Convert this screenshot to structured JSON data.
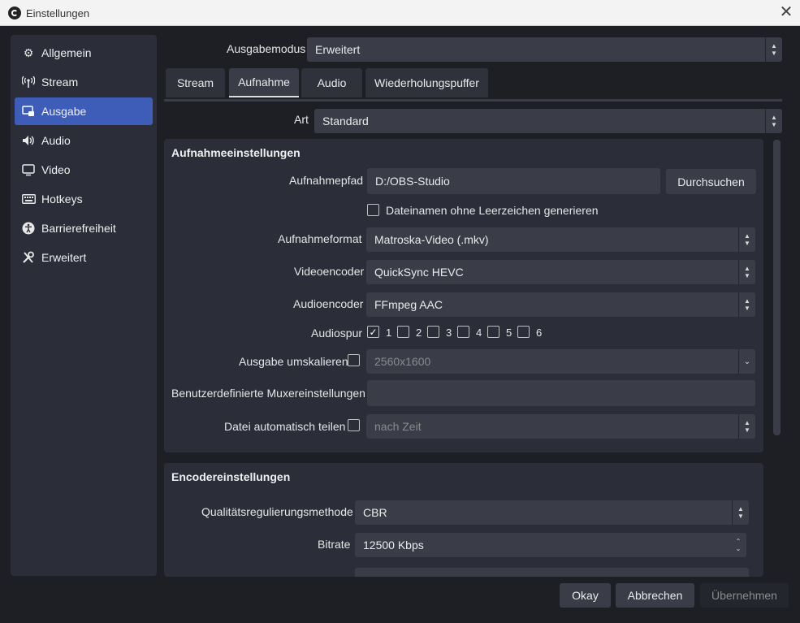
{
  "window": {
    "title": "Einstellungen"
  },
  "sidebar": {
    "items": [
      {
        "label": "Allgemein",
        "icon": "gear-icon"
      },
      {
        "label": "Stream",
        "icon": "antenna-icon"
      },
      {
        "label": "Ausgabe",
        "icon": "output-icon",
        "active": true
      },
      {
        "label": "Audio",
        "icon": "speaker-icon"
      },
      {
        "label": "Video",
        "icon": "monitor-icon"
      },
      {
        "label": "Hotkeys",
        "icon": "keyboard-icon"
      },
      {
        "label": "Barrierefreiheit",
        "icon": "accessibility-icon"
      },
      {
        "label": "Erweitert",
        "icon": "tools-icon"
      }
    ]
  },
  "output_mode": {
    "label": "Ausgabemodus",
    "value": "Erweitert"
  },
  "tabs": [
    {
      "label": "Stream"
    },
    {
      "label": "Aufnahme",
      "active": true
    },
    {
      "label": "Audio"
    },
    {
      "label": "Wiederholungspuffer"
    }
  ],
  "art": {
    "label": "Art",
    "value": "Standard"
  },
  "recording": {
    "title": "Aufnahmeeinstellungen",
    "path_label": "Aufnahmepfad",
    "path_value": "D:/OBS-Studio",
    "browse_label": "Durchsuchen",
    "nospace_label": "Dateinamen ohne Leerzeichen generieren",
    "format_label": "Aufnahmeformat",
    "format_value": "Matroska-Video (.mkv)",
    "video_encoder_label": "Videoencoder",
    "video_encoder_value": "QuickSync HEVC",
    "audio_encoder_label": "Audioencoder",
    "audio_encoder_value": "FFmpeg AAC",
    "audio_track_label": "Audiospur",
    "audio_tracks": [
      {
        "num": "1",
        "checked": true
      },
      {
        "num": "2",
        "checked": false
      },
      {
        "num": "3",
        "checked": false
      },
      {
        "num": "4",
        "checked": false
      },
      {
        "num": "5",
        "checked": false
      },
      {
        "num": "6",
        "checked": false
      }
    ],
    "rescale_label": "Ausgabe umskalieren",
    "rescale_value": "2560x1600",
    "mux_label": "Benutzerdefinierte Muxereinstellungen",
    "mux_value": "",
    "split_label": "Datei automatisch teilen",
    "split_value": "nach Zeit"
  },
  "encoder": {
    "title": "Encodereinstellungen",
    "rc_label": "Qualitätsregulierungsmethode",
    "rc_value": "CBR",
    "bitrate_label": "Bitrate",
    "bitrate_value": "12500 Kbps"
  },
  "footer": {
    "ok_label": "Okay",
    "cancel_label": "Abbrechen",
    "apply_label": "Übernehmen"
  }
}
